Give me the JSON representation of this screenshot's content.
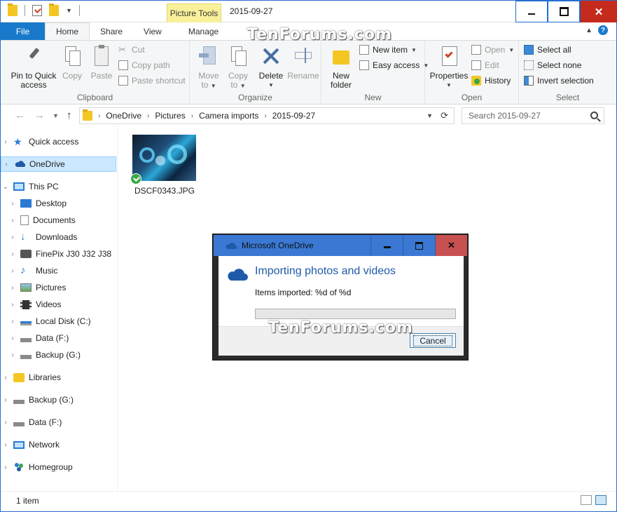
{
  "qat": {
    "title_path": "2015-09-27"
  },
  "contextual_tab": {
    "label": "Picture Tools"
  },
  "tabs": [
    "File",
    "Home",
    "Share",
    "View",
    "Manage"
  ],
  "ribbon": {
    "clipboard": {
      "label": "Clipboard",
      "pin": "Pin to Quick access",
      "pin_l1": "Pin to Quick",
      "pin_l2": "access",
      "copy": "Copy",
      "paste": "Paste",
      "cut": "Cut",
      "copy_path": "Copy path",
      "paste_shortcut": "Paste shortcut"
    },
    "organize": {
      "label": "Organize",
      "move_to_l1": "Move",
      "move_to_l2": "to",
      "copy_to_l1": "Copy",
      "copy_to_l2": "to",
      "delete": "Delete",
      "rename": "Rename"
    },
    "new": {
      "label": "New",
      "new_folder_l1": "New",
      "new_folder_l2": "folder",
      "new_item": "New item",
      "easy_access": "Easy access"
    },
    "open": {
      "label": "Open",
      "properties": "Properties",
      "open": "Open",
      "edit": "Edit",
      "history": "History"
    },
    "select": {
      "label": "Select",
      "select_all": "Select all",
      "select_none": "Select none",
      "invert": "Invert selection"
    }
  },
  "address": {
    "crumbs": [
      "OneDrive",
      "Pictures",
      "Camera imports",
      "2015-09-27"
    ]
  },
  "search": {
    "placeholder": "Search 2015-09-27"
  },
  "nav": [
    {
      "label": "Quick access"
    },
    {
      "label": "OneDrive"
    },
    {
      "label": "This PC"
    },
    {
      "label": "Desktop"
    },
    {
      "label": "Documents"
    },
    {
      "label": "Downloads"
    },
    {
      "label": "FinePix J30 J32 J38"
    },
    {
      "label": "Music"
    },
    {
      "label": "Pictures"
    },
    {
      "label": "Videos"
    },
    {
      "label": "Local Disk (C:)"
    },
    {
      "label": "Data (F:)"
    },
    {
      "label": "Backup (G:)"
    },
    {
      "label": "Libraries"
    },
    {
      "label": "Backup (G:)"
    },
    {
      "label": "Data (F:)"
    },
    {
      "label": "Network"
    },
    {
      "label": "Homegroup"
    }
  ],
  "files": [
    {
      "name": "DSCF0343.JPG"
    }
  ],
  "status": {
    "count": "1 item"
  },
  "dialog": {
    "title": "Microsoft OneDrive",
    "heading": "Importing photos and videos",
    "count_text": "Items imported: %d of %d",
    "cancel": "Cancel",
    "progress": 0.0
  },
  "watermark": "TenForums.com",
  "colors": {
    "accent": "#1979ca",
    "close": "#c42b1c",
    "contextual": "#f9f19a",
    "onedrive": "#1e5aa8"
  }
}
